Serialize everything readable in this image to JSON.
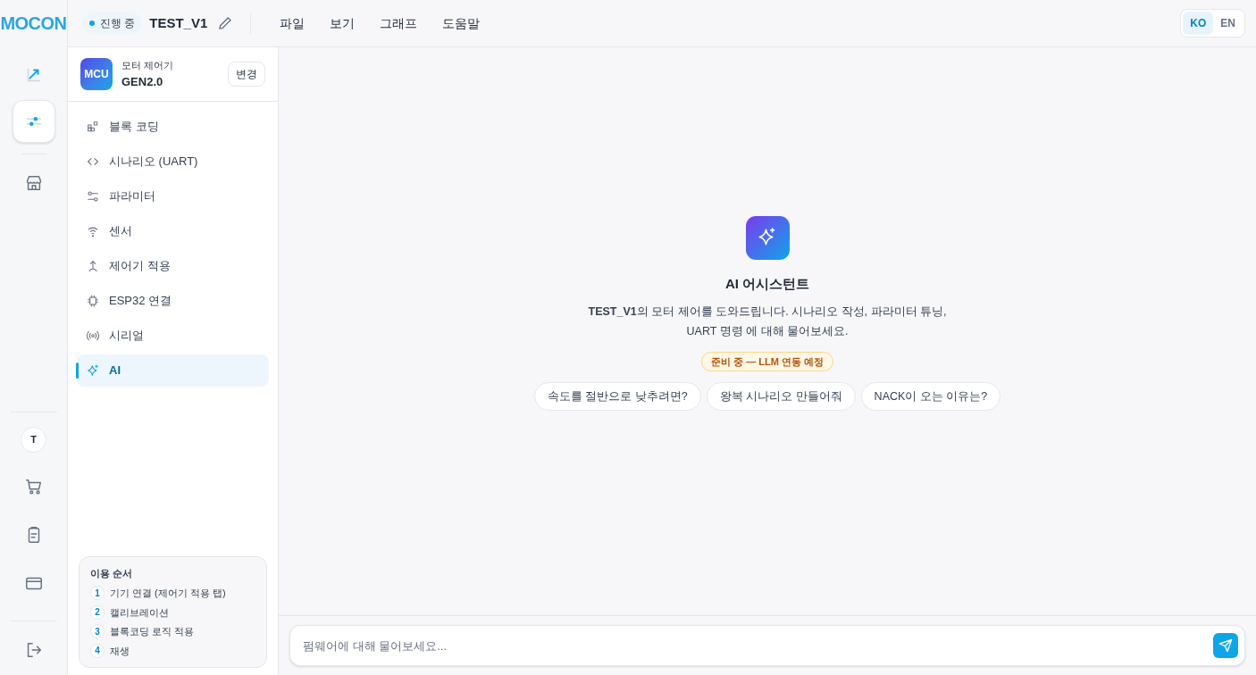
{
  "logo": "MOCON",
  "project": {
    "status": "진행 중",
    "name": "TEST_V1"
  },
  "menu": [
    "파일",
    "보기",
    "그래프",
    "도움말"
  ],
  "languages": [
    {
      "label": "KO",
      "selected": true
    },
    {
      "label": "EN",
      "selected": false
    }
  ],
  "rail_top": [
    {
      "kind": "chart",
      "selected": false
    },
    {
      "kind": "sliders",
      "selected": true
    },
    {
      "kind": "store",
      "selected": false
    }
  ],
  "rail_bottom": [
    {
      "kind": "avatar",
      "label": "T"
    },
    {
      "kind": "cart"
    },
    {
      "kind": "clipboard"
    },
    {
      "kind": "card"
    },
    {
      "kind": "logout"
    }
  ],
  "device": {
    "badge": "MCU",
    "type": "모터 제어기",
    "model": "GEN2.0",
    "button": "변경"
  },
  "nav": [
    {
      "kind": "blocks",
      "label": "블록 코딩",
      "selected": false
    },
    {
      "kind": "code",
      "label": "시나리오 (UART)",
      "selected": false
    },
    {
      "kind": "params",
      "label": "파라미터",
      "selected": false
    },
    {
      "kind": "sensor",
      "label": "센서",
      "selected": false
    },
    {
      "kind": "apply",
      "label": "제어기 적용",
      "selected": false
    },
    {
      "kind": "chip",
      "label": "ESP32 연결",
      "selected": false
    },
    {
      "kind": "serial",
      "label": "시리얼",
      "selected": false
    },
    {
      "kind": "ai",
      "label": "AI",
      "selected": true
    }
  ],
  "guide": {
    "title": "이용 순서",
    "steps": [
      {
        "number": "1",
        "text": "기기 연결 (제어기 적용 탭)"
      },
      {
        "number": "2",
        "text": "캘리브레이션"
      },
      {
        "number": "3",
        "text": "블록코딩 로직 적용"
      },
      {
        "number": "4",
        "text": "재생"
      }
    ]
  },
  "assistant": {
    "title": "AI 어시스턴트",
    "description": "**TEST_V1**의 모터 제어를 도와드립니다. 시나리오 작성, 파라미터 튜닝, UART 명령 에 대해 물어보세요.",
    "badge": "준비 중 — LLM 연동 예정",
    "suggestions": [
      "속도를 절반으로 낮추려면?",
      "왕복 시나리오 만들어줘",
      "NACK이 오는 이유는?"
    ]
  },
  "input": {
    "placeholder": "펌웨어에 대해 물어보세요..."
  }
}
